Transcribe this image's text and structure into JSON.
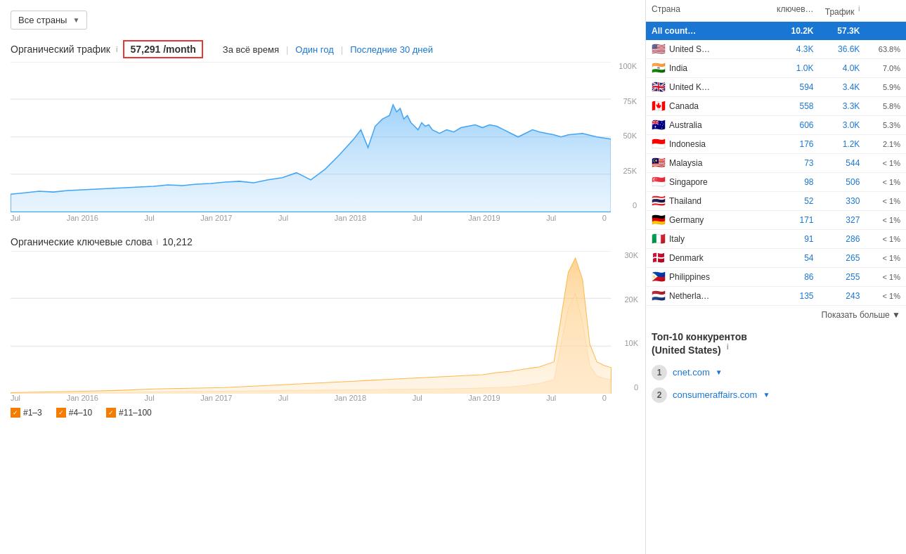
{
  "dropdown": {
    "label": "Все страны",
    "arrow": "▼"
  },
  "organic_traffic": {
    "title": "Органический трафик",
    "value": "57,291 /month",
    "info": "i",
    "time_filters": [
      {
        "label": "За всё время",
        "type": "plain"
      },
      {
        "label": "Один год",
        "type": "link"
      },
      {
        "label": "Последние 30 дней",
        "type": "link"
      }
    ],
    "y_labels": [
      "100K",
      "75K",
      "50K",
      "25K",
      "0"
    ],
    "x_labels": [
      "Jul",
      "Jan 2016",
      "Jul",
      "Jan 2017",
      "Jul",
      "Jan 2018",
      "Jul",
      "Jan 2019",
      "Jul",
      "0"
    ]
  },
  "keywords": {
    "title": "Органические ключевые слова",
    "info": "i",
    "value": "10,212",
    "y_labels": [
      "30K",
      "20K",
      "10K",
      "0"
    ],
    "x_labels": [
      "Jul",
      "Jan 2016",
      "Jul",
      "Jan 2017",
      "Jul",
      "Jan 2018",
      "Jul",
      "Jan 2019",
      "Jul",
      "0"
    ],
    "legend": [
      {
        "label": "#1–3",
        "color": "#f57c00"
      },
      {
        "label": "#4–10",
        "color": "#f57c00"
      },
      {
        "label": "#11–100",
        "color": "#f57c00"
      }
    ]
  },
  "table": {
    "headers": {
      "country": "Страна",
      "keywords": "ключев…",
      "traffic": "Трафик",
      "info": "i"
    },
    "header_row": {
      "country": "All count…",
      "keywords": "10.2K",
      "traffic": "57.3K"
    },
    "rows": [
      {
        "flag": "🇺🇸",
        "country": "United S…",
        "keywords": "4.3K",
        "traffic": "36.6K",
        "percent": "63.8%"
      },
      {
        "flag": "🇮🇳",
        "country": "India",
        "keywords": "1.0K",
        "traffic": "4.0K",
        "percent": "7.0%"
      },
      {
        "flag": "🇬🇧",
        "country": "United K…",
        "keywords": "594",
        "traffic": "3.4K",
        "percent": "5.9%"
      },
      {
        "flag": "🇨🇦",
        "country": "Canada",
        "keywords": "558",
        "traffic": "3.3K",
        "percent": "5.8%"
      },
      {
        "flag": "🇦🇺",
        "country": "Australia",
        "keywords": "606",
        "traffic": "3.0K",
        "percent": "5.3%"
      },
      {
        "flag": "🇮🇩",
        "country": "Indonesia",
        "keywords": "176",
        "traffic": "1.2K",
        "percent": "2.1%"
      },
      {
        "flag": "🇲🇾",
        "country": "Malaysia",
        "keywords": "73",
        "traffic": "544",
        "percent": "< 1%"
      },
      {
        "flag": "🇸🇬",
        "country": "Singapore",
        "keywords": "98",
        "traffic": "506",
        "percent": "< 1%"
      },
      {
        "flag": "🇹🇭",
        "country": "Thailand",
        "keywords": "52",
        "traffic": "330",
        "percent": "< 1%"
      },
      {
        "flag": "🇩🇪",
        "country": "Germany",
        "keywords": "171",
        "traffic": "327",
        "percent": "< 1%"
      },
      {
        "flag": "🇮🇹",
        "country": "Italy",
        "keywords": "91",
        "traffic": "286",
        "percent": "< 1%"
      },
      {
        "flag": "🇩🇰",
        "country": "Denmark",
        "keywords": "54",
        "traffic": "265",
        "percent": "< 1%"
      },
      {
        "flag": "🇵🇭",
        "country": "Philippines",
        "keywords": "86",
        "traffic": "255",
        "percent": "< 1%"
      },
      {
        "flag": "🇳🇱",
        "country": "Netherla…",
        "keywords": "135",
        "traffic": "243",
        "percent": "< 1%"
      }
    ],
    "show_more": "Показать больше ▼"
  },
  "competitors": {
    "title": "Топ-10 конкурентов\n(United States)",
    "info": "i",
    "items": [
      {
        "num": "1",
        "link": "cnet.com",
        "arrow": "▼"
      },
      {
        "num": "2",
        "link": "consumeraffairs.com",
        "arrow": "▼"
      }
    ]
  }
}
